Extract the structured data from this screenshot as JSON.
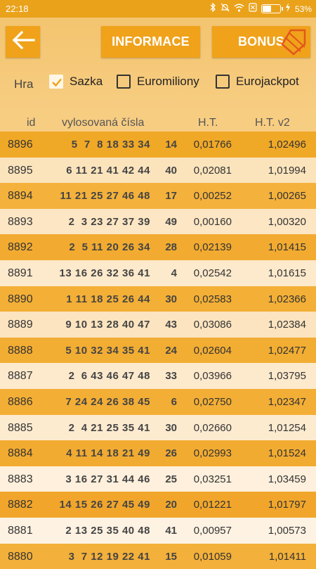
{
  "statusbar": {
    "time": "22:18",
    "battery_text": "53%",
    "battery_level": 0.53,
    "icons": [
      "bluetooth-icon",
      "mute-icon",
      "wifi-icon",
      "sim-icon",
      "battery-icon",
      "charging-icon"
    ]
  },
  "toolbar": {
    "back_icon": "arrow-left-icon",
    "info_label": "INFORMACE",
    "bonus_label": "BONUS"
  },
  "filter": {
    "label": "Hra",
    "options": [
      {
        "label": "Sazka",
        "checked": true
      },
      {
        "label": "Euromiliony",
        "checked": false
      },
      {
        "label": "Eurojackpot",
        "checked": false
      }
    ]
  },
  "table": {
    "headers": {
      "id": "id",
      "numbers": "vylosovaná čísla",
      "ht": "H.T.",
      "ht2": "H.T. v2"
    },
    "rows": [
      {
        "id": "8896",
        "nums": "5  7  8 18 33 34",
        "extra": "14",
        "ht": "0,01766",
        "ht2": "1,02496"
      },
      {
        "id": "8895",
        "nums": "6 11 21 41 42 44",
        "extra": "40",
        "ht": "0,02081",
        "ht2": "1,01994"
      },
      {
        "id": "8894",
        "nums": "11 21 25 27 46 48",
        "extra": "17",
        "ht": "0,00252",
        "ht2": "1,00265"
      },
      {
        "id": "8893",
        "nums": "2  3 23 27 37 39",
        "extra": "49",
        "ht": "0,00160",
        "ht2": "1,00320"
      },
      {
        "id": "8892",
        "nums": "2  5 11 20 26 34",
        "extra": "28",
        "ht": "0,02139",
        "ht2": "1,01415"
      },
      {
        "id": "8891",
        "nums": "13 16 26 32 36 41",
        "extra": "4",
        "ht": "0,02542",
        "ht2": "1,01615"
      },
      {
        "id": "8890",
        "nums": "1 11 18 25 26 44",
        "extra": "30",
        "ht": "0,02583",
        "ht2": "1,02366"
      },
      {
        "id": "8889",
        "nums": "9 10 13 28 40 47",
        "extra": "43",
        "ht": "0,03086",
        "ht2": "1,02384"
      },
      {
        "id": "8888",
        "nums": "5 10 32 34 35 41",
        "extra": "24",
        "ht": "0,02604",
        "ht2": "1,02477"
      },
      {
        "id": "8887",
        "nums": "2  6 43 46 47 48",
        "extra": "33",
        "ht": "0,03966",
        "ht2": "1,03795"
      },
      {
        "id": "8886",
        "nums": "7 24 24 26 38 45",
        "extra": "6",
        "ht": "0,02750",
        "ht2": "1,02347"
      },
      {
        "id": "8885",
        "nums": "2  4 21 25 35 41",
        "extra": "30",
        "ht": "0,02660",
        "ht2": "1,01254"
      },
      {
        "id": "8884",
        "nums": "4 11 14 18 21 49",
        "extra": "26",
        "ht": "0,02993",
        "ht2": "1,01524"
      },
      {
        "id": "8883",
        "nums": "3 16 27 31 44 46",
        "extra": "25",
        "ht": "0,03251",
        "ht2": "1,03459"
      },
      {
        "id": "8882",
        "nums": "14 15 26 27 45 49",
        "extra": "20",
        "ht": "0,01221",
        "ht2": "1,01797"
      },
      {
        "id": "8881",
        "nums": "2 13 25 35 40 48",
        "extra": "41",
        "ht": "0,00957",
        "ht2": "1,00573"
      },
      {
        "id": "8880",
        "nums": "3  7 12 19 22 41",
        "extra": "15",
        "ht": "0,01059",
        "ht2": "1,01411"
      }
    ],
    "row_colors": [
      "#f0a827",
      "#fbe4bc",
      "#f4b13b",
      "#fce6c4",
      "#f2ab30",
      "#fde9cb",
      "#f3af36",
      "#fbe4bf",
      "#f2ad33",
      "#fde9cc",
      "#f3ae35",
      "#fdebd0",
      "#f2ab31",
      "#fef0dc",
      "#f1a62b",
      "#fef2e2",
      "#f3b03a"
    ]
  }
}
